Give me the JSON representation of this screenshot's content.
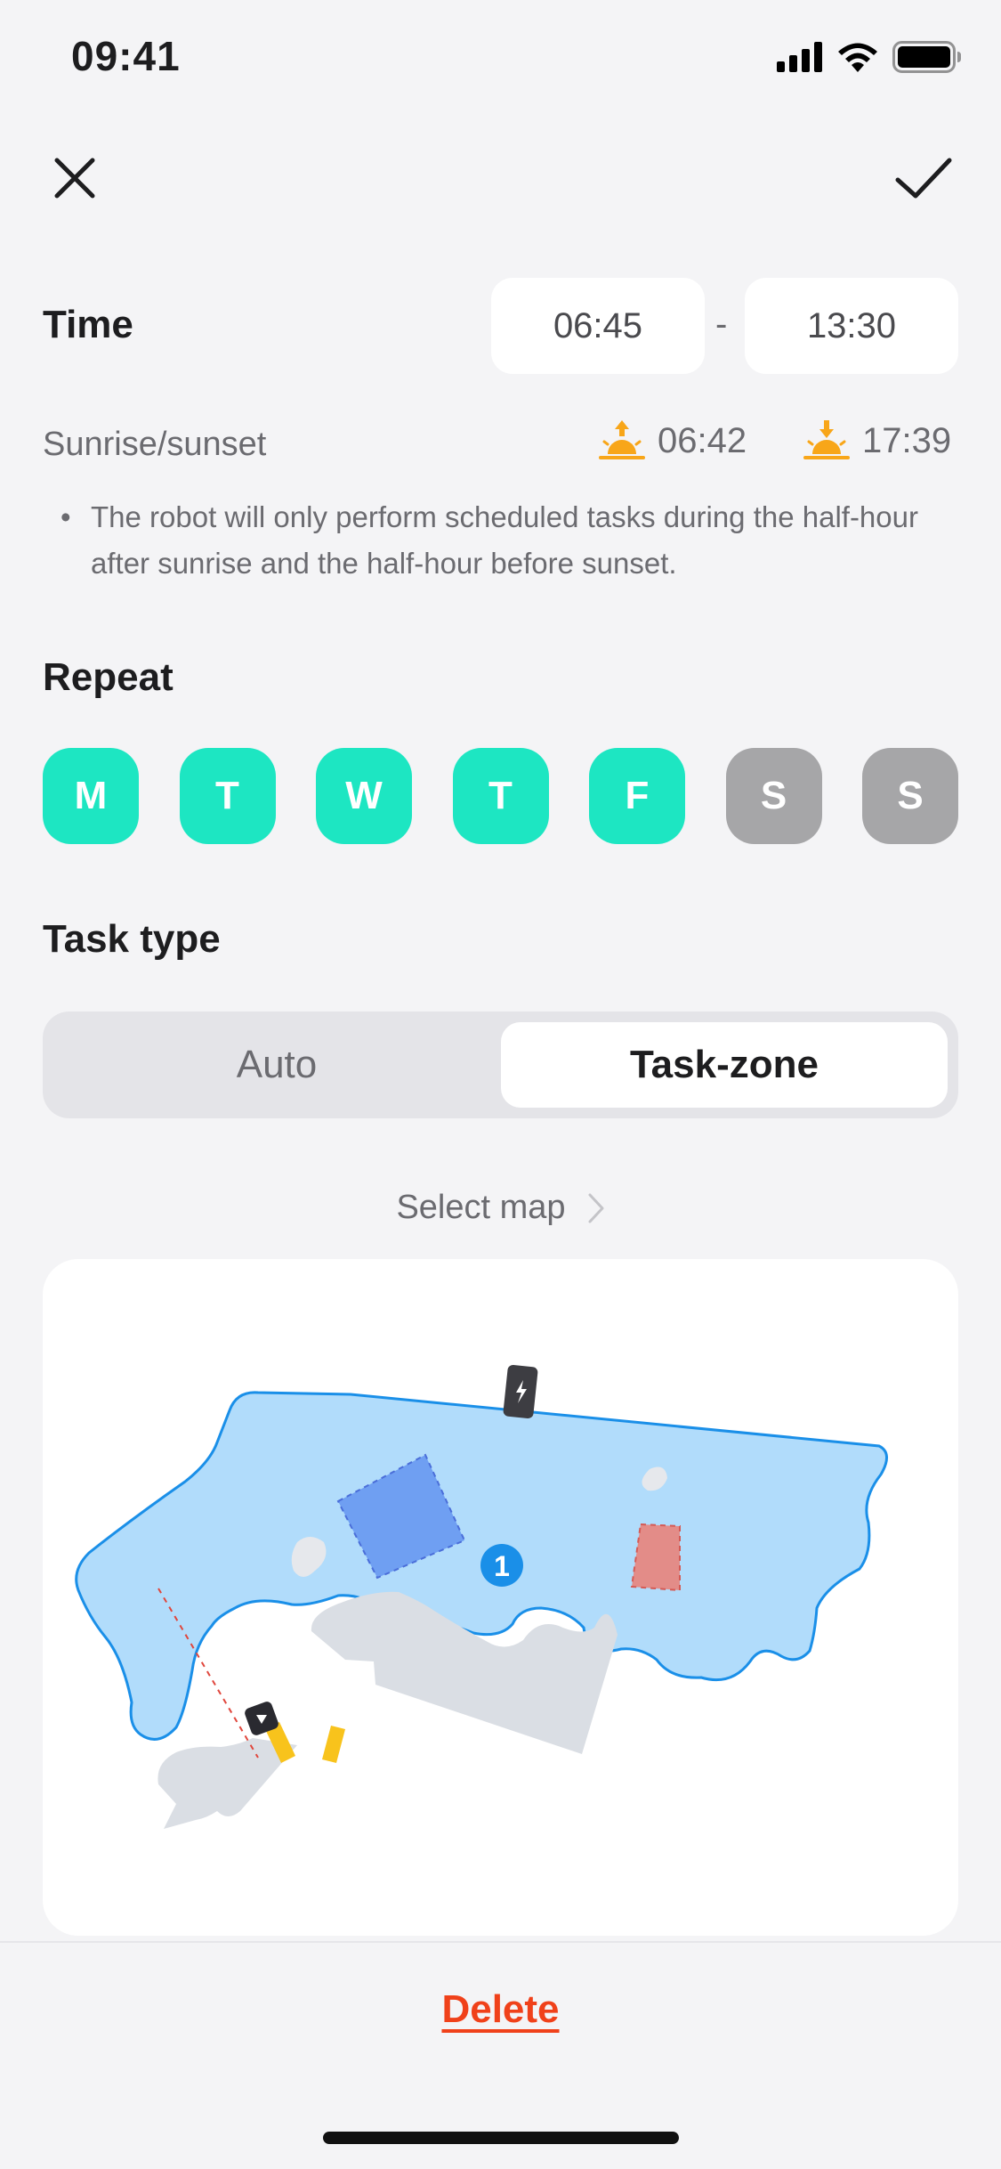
{
  "status_bar": {
    "time": "09:41"
  },
  "schedule": {
    "time_label": "Time",
    "start_time": "06:45",
    "separator": "-",
    "end_time": "13:30",
    "sun_label": "Sunrise/sunset",
    "sunrise_time": "06:42",
    "sunset_time": "17:39",
    "note": "The robot will only perform scheduled tasks during the half-hour after sunrise and the half-hour before sunset."
  },
  "repeat": {
    "title": "Repeat",
    "days": [
      {
        "label": "M",
        "active": true
      },
      {
        "label": "T",
        "active": true
      },
      {
        "label": "W",
        "active": true
      },
      {
        "label": "T",
        "active": true
      },
      {
        "label": "F",
        "active": true
      },
      {
        "label": "S",
        "active": false
      },
      {
        "label": "S",
        "active": false
      }
    ]
  },
  "task_type": {
    "title": "Task type",
    "options": [
      "Auto",
      "Task-zone"
    ],
    "selected": "Task-zone"
  },
  "map": {
    "select_label": "Select map",
    "zone_badge": "1"
  },
  "actions": {
    "delete_label": "Delete"
  },
  "colors": {
    "accent": "#1de6c2",
    "inactive_day": "#a6a6a8",
    "delete": "#f0411a",
    "lawn": "#b1dcfb",
    "lawn_border": "#1a8fe8",
    "zone_blue": "#6f9ff2",
    "zone_red": "#e38c88",
    "path_yellow": "#f8c31c",
    "sun": "#f8a619"
  }
}
